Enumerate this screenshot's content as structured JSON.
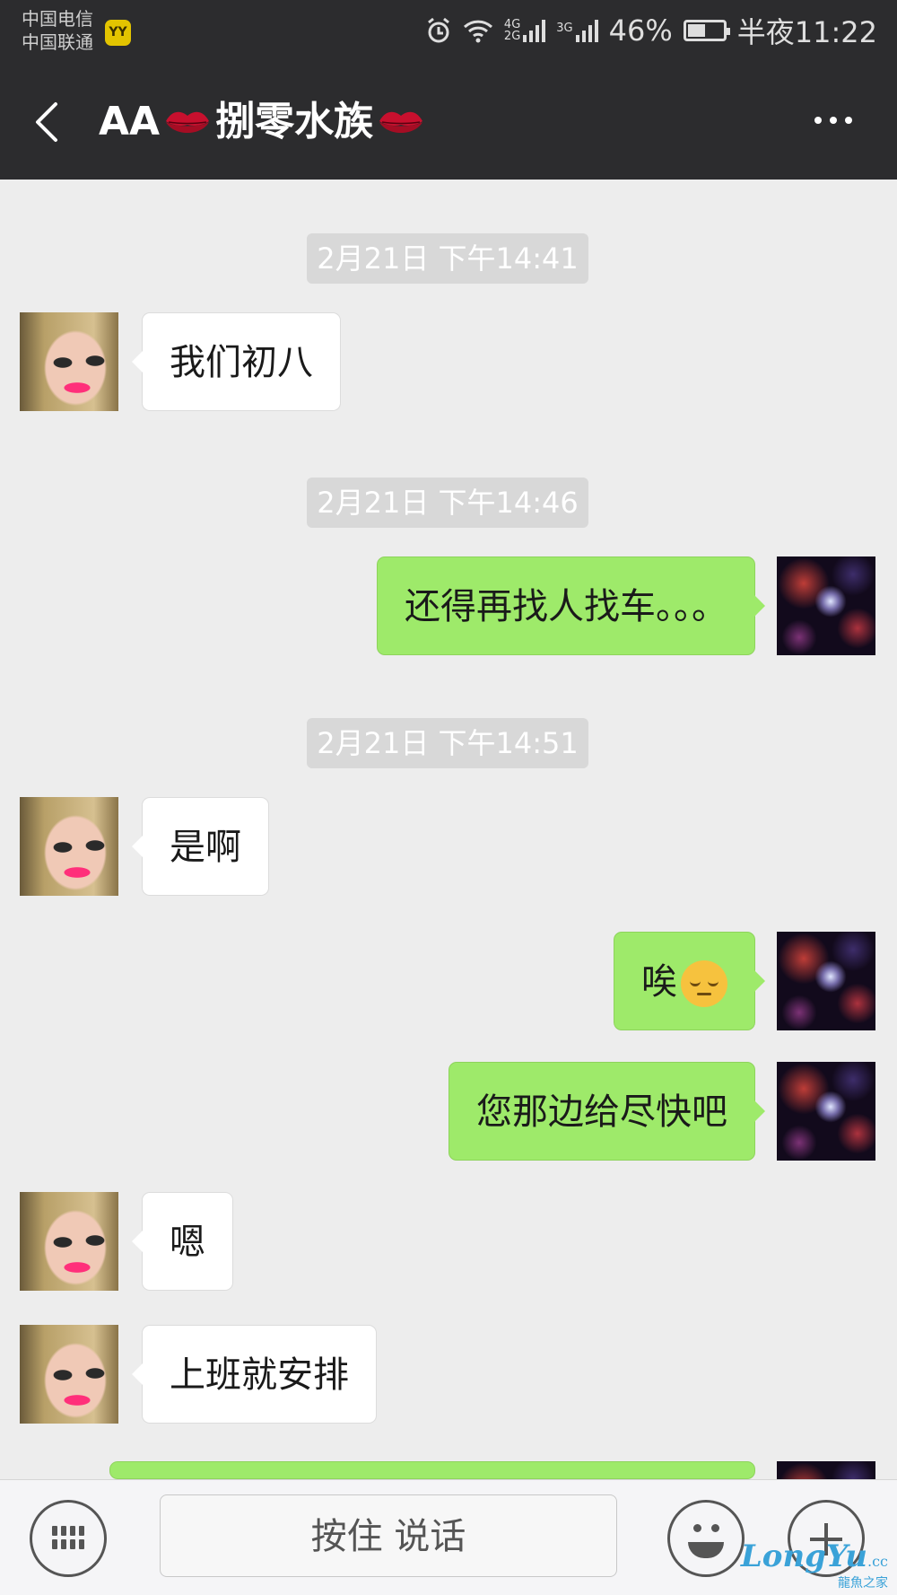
{
  "status_bar": {
    "carrier_1": "中国电信",
    "carrier_2": "中国联通",
    "app_badge": "YY",
    "net_1": "4G",
    "net_2": "2G",
    "net_3": "3G",
    "battery": "46%",
    "time": "半夜11:22"
  },
  "header": {
    "title_prefix": "AA",
    "title_main": "捌零水族",
    "back_icon": "back-arrow-icon",
    "more_icon": "more-icon"
  },
  "messages": [
    {
      "type": "time",
      "text": "2月21日 下午14:41"
    },
    {
      "type": "them",
      "text": "我们初八"
    },
    {
      "type": "time",
      "text": "2月21日 下午14:46"
    },
    {
      "type": "me",
      "text": "还得再找人找车。。。"
    },
    {
      "type": "time",
      "text": "2月21日 下午14:51"
    },
    {
      "type": "them",
      "text": "是啊"
    },
    {
      "type": "me",
      "text": "唉",
      "emoji": "pensive-face-emoji"
    },
    {
      "type": "me",
      "text": "您那边给尽快吧"
    },
    {
      "type": "them",
      "text": "嗯"
    },
    {
      "type": "them",
      "text": "上班就安排"
    }
  ],
  "input_bar": {
    "hold_to_talk": "按住 说话",
    "keyboard_icon": "keyboard-icon",
    "emoji_icon": "emoji-icon",
    "plus_icon": "plus-icon"
  },
  "watermark": {
    "text": "LongYu",
    "suffix": ".cc",
    "subtitle": "龍魚之家"
  },
  "colors": {
    "header_bg": "#2c2c2e",
    "chat_bg": "#ededed",
    "my_bubble": "#9eea6a",
    "their_bubble": "#ffffff",
    "lips": "#c8102e"
  }
}
